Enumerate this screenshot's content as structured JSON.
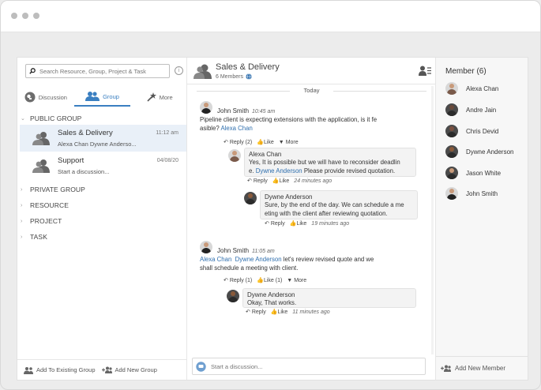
{
  "left": {
    "search_placeholder": "Search Resource, Group, Project & Task",
    "tabs": [
      {
        "label": "Discussion"
      },
      {
        "label": "Group"
      },
      {
        "label": "More"
      }
    ],
    "sections": {
      "public": "PUBLIC GROUP",
      "private": "PRIVATE GROUP",
      "resource": "RESOURCE",
      "project": "PROJECT",
      "task": "TASK"
    },
    "groups": [
      {
        "name": "Sales & Delivery",
        "sub": "Alexa Chan Dywne Anderso...",
        "time": "11:12 am"
      },
      {
        "name": "Support",
        "sub": "Start a discussion...",
        "time": "04/08/20"
      }
    ],
    "footer": {
      "add_existing": "Add To Existing Group",
      "add_new": "Add New Group"
    }
  },
  "mid": {
    "title": "Sales & Delivery",
    "members_count": "6 Members",
    "day_divider": "Today",
    "composer_placeholder": "Start a discussion...",
    "messages": [
      {
        "author": "John Smith",
        "time": "10:45 am",
        "text_line1": "Pipeline client is expecting extensions with the application, is it fe",
        "text_line2": "asible?",
        "mention": "Alexa Chan",
        "reply": "Reply (2)",
        "like": "Like",
        "more": "More"
      },
      {
        "author": "Alexa Chan",
        "text_line1": "Yes, It is possible but we will have to reconsider deadlin",
        "text_pre": "e.",
        "mention": "Dywne Anderson",
        "text_post": "Please provide revised quotation.",
        "reply": "Reply",
        "like": "Like",
        "time": "24 minutes ago"
      },
      {
        "author": "Dywne Anderson",
        "text_line1": "Sure, by the end of the day. We can schedule a me",
        "text_line2": "eting with the client after reviewing quotation.",
        "reply": "Reply",
        "like": "Like",
        "time": "19 minutes ago"
      },
      {
        "author": "John Smith",
        "time": "11:05 am",
        "mention1": "Alexa Chan",
        "mention2": "Dywne Anderson",
        "text_line1": "let's review revised quote and we",
        "text_line2": "shall schedule a meeting with client.",
        "reply": "Reply (1)",
        "like": "Like (1)",
        "more": "More"
      },
      {
        "author": "Dywne Anderson",
        "text_line1": "Okay, That works.",
        "reply": "Reply",
        "like": "Like",
        "time": "11 minutes ago"
      }
    ]
  },
  "right": {
    "title": "Member (6)",
    "members": [
      "Alexa Chan",
      "Andre Jain",
      "Chris Devid",
      "Dywne Anderson",
      "Jason White",
      "John Smith"
    ],
    "add_member": "Add New Member"
  },
  "colors": {
    "accent": "#3a7fc1",
    "mention": "#2f6fae",
    "active_row": "#e9f0f8"
  }
}
